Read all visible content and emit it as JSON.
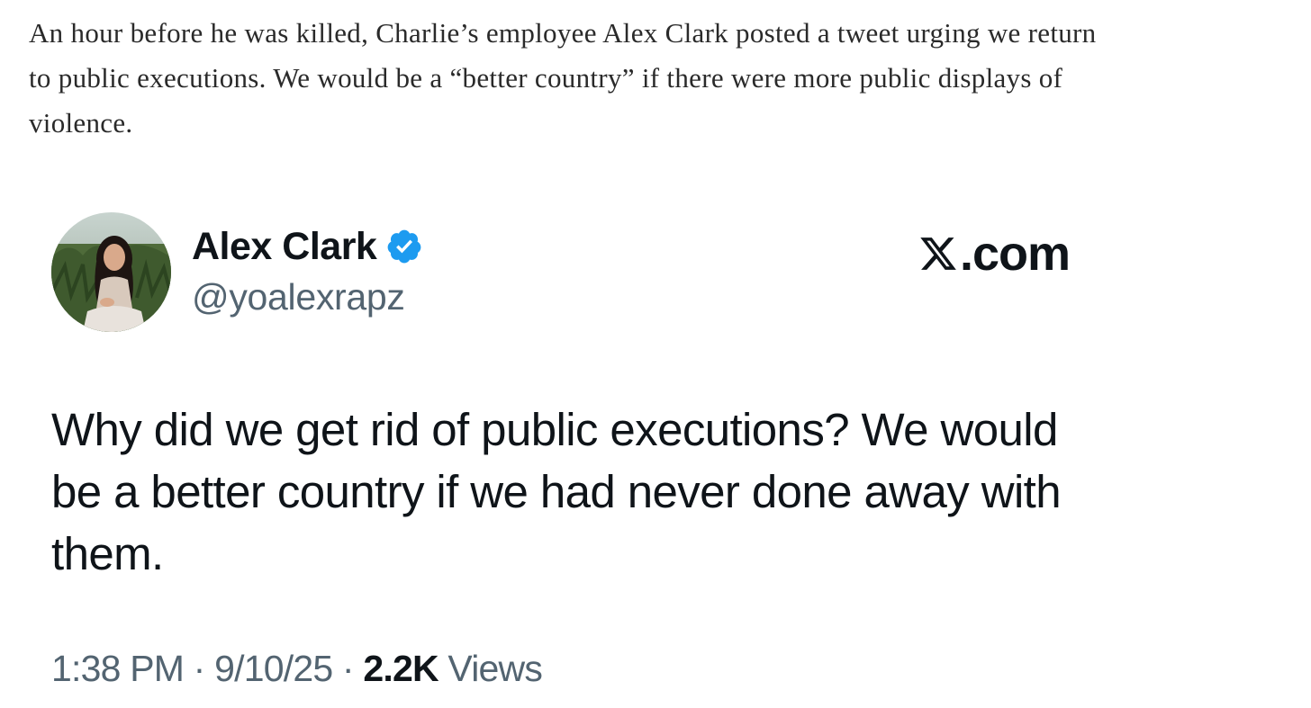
{
  "article": {
    "paragraph": "An hour before he was killed, Charlie’s employee Alex Clark posted a tweet urging we return to public executions. We would be a “better country” if there were more public displays of violence."
  },
  "tweet": {
    "author_name": "Alex Clark",
    "author_handle": "@yoalexrapz",
    "verified": true,
    "avatar_icon": "profile-photo",
    "source_icon": "x-logo-icon",
    "source_domain": ".com",
    "text": "Why did we get rid of public executions? We would be a better country if we had never done away with them.",
    "time": "1:38 PM",
    "separator": " · ",
    "date": "9/10/25",
    "views_count": "2.2K",
    "views_label": " Views"
  },
  "colors": {
    "verified_blue": "#1d9bf0",
    "text_primary": "#0f1419",
    "text_secondary": "#536471"
  }
}
